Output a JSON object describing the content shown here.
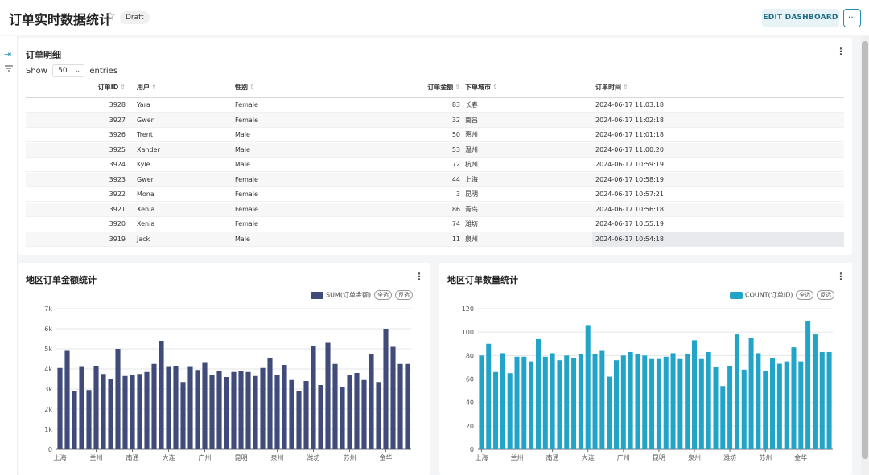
{
  "header": {
    "title": "订单实时数据统计",
    "star_icon": "star-icon",
    "badge": "Draft",
    "edit_label": "EDIT DASHBOARD",
    "more_label": "···"
  },
  "sidebar": {
    "expand_icon": "⇥",
    "filter_icon": "filter-icon"
  },
  "table_card": {
    "title": "订单明细",
    "menu": "⋮",
    "show_label": "Show",
    "entries_value": "50",
    "entries_label": "entries",
    "columns": [
      "订单ID",
      "用户",
      "性别",
      "订单金额",
      "下单城市",
      "订单时间"
    ],
    "rows": [
      [
        "3928",
        "Yara",
        "Female",
        "83",
        "长春",
        "2024-06-17 11:03:18"
      ],
      [
        "3927",
        "Gwen",
        "Female",
        "32",
        "南昌",
        "2024-06-17 11:02:18"
      ],
      [
        "3926",
        "Trent",
        "Male",
        "50",
        "惠州",
        "2024-06-17 11:01:18"
      ],
      [
        "3925",
        "Xander",
        "Male",
        "53",
        "温州",
        "2024-06-17 11:00:20"
      ],
      [
        "3924",
        "Kyle",
        "Male",
        "72",
        "杭州",
        "2024-06-17 10:59:19"
      ],
      [
        "3923",
        "Gwen",
        "Female",
        "44",
        "上海",
        "2024-06-17 10:58:19"
      ],
      [
        "3922",
        "Mona",
        "Female",
        "3",
        "昆明",
        "2024-06-17 10:57:21"
      ],
      [
        "3921",
        "Xenia",
        "Female",
        "86",
        "青岛",
        "2024-06-17 10:56:18"
      ],
      [
        "3920",
        "Xenia",
        "Female",
        "74",
        "潍坊",
        "2024-06-17 10:55:19"
      ],
      [
        "3919",
        "Jack",
        "Male",
        "11",
        "泉州",
        "2024-06-17 10:54:18"
      ]
    ]
  },
  "chart_cards": {
    "left_title": "地区订单金额统计",
    "right_title": "地区订单数量统计",
    "menu": "⋮",
    "select_all": "全选",
    "invert": "反选"
  },
  "chart_data": [
    {
      "type": "bar",
      "title": "地区订单金额统计",
      "legend": "SUM(订单金额)",
      "legend_position": "top-right",
      "color": "#414b7a",
      "ylim": [
        0,
        7000
      ],
      "yticks": [
        "0",
        "1k",
        "2k",
        "3k",
        "4k",
        "5k",
        "6k",
        "7k"
      ],
      "ytick_values": [
        0,
        1000,
        2000,
        3000,
        4000,
        5000,
        6000,
        7000
      ],
      "grid": true,
      "xtick_labels": [
        "上海",
        "兰州",
        "南通",
        "大连",
        "广州",
        "昆明",
        "泉州",
        "潍坊",
        "苏州",
        "金华"
      ],
      "xtick_index": [
        0,
        5,
        10,
        15,
        20,
        25,
        30,
        35,
        40,
        45
      ],
      "values": [
        4050,
        4900,
        2900,
        4100,
        2950,
        4150,
        3750,
        3500,
        5000,
        3650,
        3700,
        3750,
        3850,
        4250,
        5400,
        4100,
        4150,
        3350,
        4100,
        3950,
        4300,
        3700,
        3900,
        3600,
        3850,
        3900,
        3850,
        3650,
        4050,
        4550,
        3700,
        4200,
        3450,
        2900,
        3400,
        5150,
        3200,
        5300,
        4250,
        3100,
        3700,
        3800,
        3450,
        4750,
        3350,
        6000,
        5100,
        4250,
        4250
      ]
    },
    {
      "type": "bar",
      "title": "地区订单数量统计",
      "legend": "COUNT(订单ID)",
      "legend_position": "top-right",
      "color": "#21a4c8",
      "ylim": [
        0,
        120
      ],
      "yticks": [
        "0",
        "20",
        "40",
        "60",
        "80",
        "100",
        "120"
      ],
      "ytick_values": [
        0,
        20,
        40,
        60,
        80,
        100,
        120
      ],
      "grid": true,
      "xtick_labels": [
        "上海",
        "兰州",
        "南通",
        "大连",
        "广州",
        "昆明",
        "泉州",
        "潍坊",
        "苏州",
        "金华"
      ],
      "xtick_index": [
        0,
        5,
        10,
        15,
        20,
        25,
        30,
        35,
        40,
        45
      ],
      "values": [
        80,
        90,
        66,
        82,
        65,
        79,
        79,
        75,
        94,
        79,
        82,
        76,
        80,
        78,
        81,
        106,
        81,
        84,
        62,
        76,
        80,
        83,
        81,
        80,
        77,
        77,
        79,
        82,
        77,
        81,
        93,
        77,
        83,
        70,
        54,
        71,
        98,
        68,
        95,
        82,
        67,
        78,
        73,
        75,
        87,
        75,
        109,
        98,
        83,
        83
      ]
    }
  ]
}
